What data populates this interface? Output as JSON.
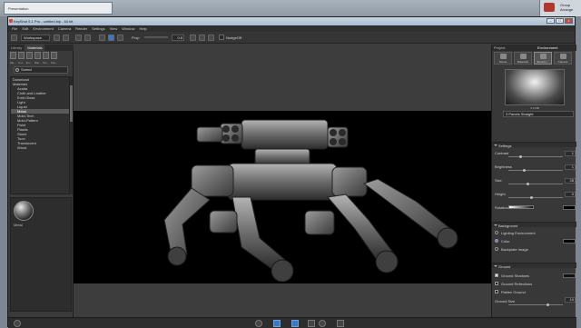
{
  "host": {
    "doc_title": "Presentation",
    "widget_label": "Group\nArrange"
  },
  "window": {
    "title": "KeyShot 5.1 Pro - untitled.bip - 64 bit"
  },
  "menu": [
    "File",
    "Edit",
    "Environment",
    "Camera",
    "Render",
    "Settings",
    "View",
    "Window",
    "Help"
  ],
  "toolbar": {
    "mode_select": "Workspace",
    "prop_label": "Prop",
    "prop_value": "0.8",
    "nudge_label": "NudgeOff"
  },
  "library": {
    "tabs": [
      "Library",
      "Materials"
    ],
    "icons": [
      "Ma...",
      "Col...",
      "En...",
      "Bac...",
      "Tex...",
      "Fav..."
    ],
    "search_value": "Sorted",
    "tree": [
      "Download",
      "Materials",
      "Axalta",
      "Cloth and Leather",
      "Emit.Gloss",
      "Light",
      "Liquid",
      "Metal",
      "Mold-Tech",
      "Mold-Pattern",
      "Paint",
      "Plastic",
      "Stone",
      "Toon",
      "Translucent",
      "Wood"
    ],
    "selected_index": 7,
    "thumbnail_label": "Metal"
  },
  "project": {
    "title": "Project",
    "tab": "Environment",
    "icons": [
      "Scene",
      "Materials",
      "Environ...",
      "Camera",
      "Settings"
    ],
    "hdri_caption": "3.2 MB",
    "env_select": "3 Panels Straight",
    "settings_title": "Settings",
    "settings": [
      {
        "label": "Contrast",
        "value": "1"
      },
      {
        "label": "Brightness",
        "value": "1"
      },
      {
        "label": "Size",
        "value": "28"
      },
      {
        "label": "Height",
        "value": "0"
      },
      {
        "label": "Rotation",
        "value": ""
      }
    ],
    "background_title": "Background",
    "background_options": [
      "Lighting Environment",
      "Color",
      "Backplate Image"
    ],
    "background_selected": 1,
    "ground_title": "Ground",
    "ground_options": [
      "Ground Shadows",
      "Ground Reflections",
      "Flatten Ground"
    ],
    "ground_checked": [
      true,
      false,
      false
    ],
    "ground_size_label": "Ground Size",
    "ground_size_value": "10"
  },
  "colors": {
    "accent": "#3a78c3",
    "render_bg": "#000000",
    "panel": "#383838"
  }
}
